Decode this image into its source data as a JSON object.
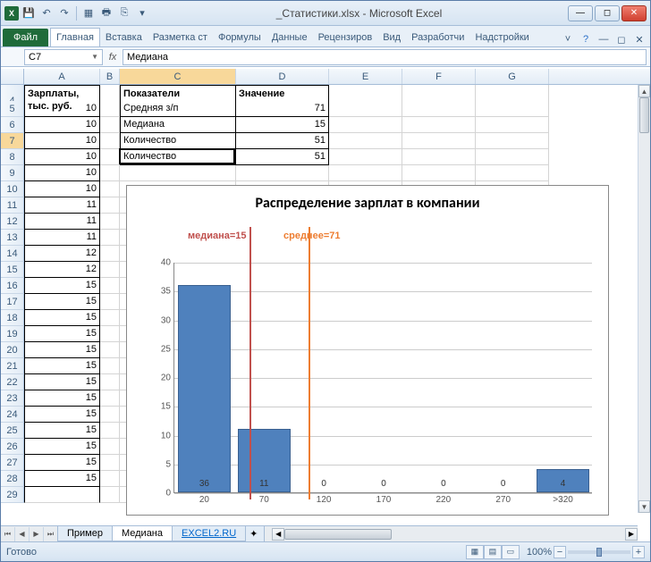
{
  "window": {
    "title": "_Статистики.xlsx - Microsoft Excel",
    "app_icon_text": "X"
  },
  "ribbon": {
    "file": "Файл",
    "tabs": [
      "Главная",
      "Вставка",
      "Разметка ст",
      "Формулы",
      "Данные",
      "Рецензиров",
      "Вид",
      "Разработчи",
      "Надстройки"
    ]
  },
  "name_box": "C7",
  "formula_bar": "Медиана",
  "columns": [
    "A",
    "B",
    "C",
    "D",
    "E",
    "F",
    "G"
  ],
  "rows_visible": [
    4,
    5,
    6,
    7,
    8,
    9,
    10,
    11,
    12,
    13,
    14,
    15,
    16,
    17,
    18,
    19,
    20,
    21,
    22,
    23,
    24,
    25,
    26,
    27,
    28,
    29
  ],
  "col_a_header": "Зарплаты, тыс. руб.",
  "col_a_values": [
    "",
    "10",
    "10",
    "10",
    "10",
    "10",
    "10",
    "11",
    "11",
    "11",
    "12",
    "12",
    "15",
    "15",
    "15",
    "15",
    "15",
    "15",
    "15",
    "15",
    "15",
    "15",
    "15",
    "15",
    "15"
  ],
  "table": {
    "h1": "Показатели",
    "h2": "Значение",
    "rows": [
      {
        "label": "Средняя з/п",
        "value": "71"
      },
      {
        "label": "Медиана",
        "value": "15"
      },
      {
        "label": "Количество",
        "value": "51"
      }
    ]
  },
  "chart_data": {
    "type": "bar",
    "title": "Распределение зарплат в компании",
    "categories": [
      "20",
      "70",
      "120",
      "170",
      "220",
      "270",
      ">320"
    ],
    "values": [
      36,
      11,
      0,
      0,
      0,
      0,
      4
    ],
    "ylim": [
      0,
      40
    ],
    "yticks": [
      0,
      5,
      10,
      15,
      20,
      25,
      30,
      35,
      40
    ],
    "annotations": [
      {
        "text": "медиана=15",
        "x_pos": 18,
        "color": "red"
      },
      {
        "text": "среднее=71",
        "x_pos": 32,
        "color": "org"
      }
    ]
  },
  "sheets": {
    "tabs": [
      "Пример",
      "Медиана",
      "EXCEL2.RU"
    ],
    "active_index": 1
  },
  "statusbar": {
    "ready": "Готово",
    "zoom": "100%"
  }
}
